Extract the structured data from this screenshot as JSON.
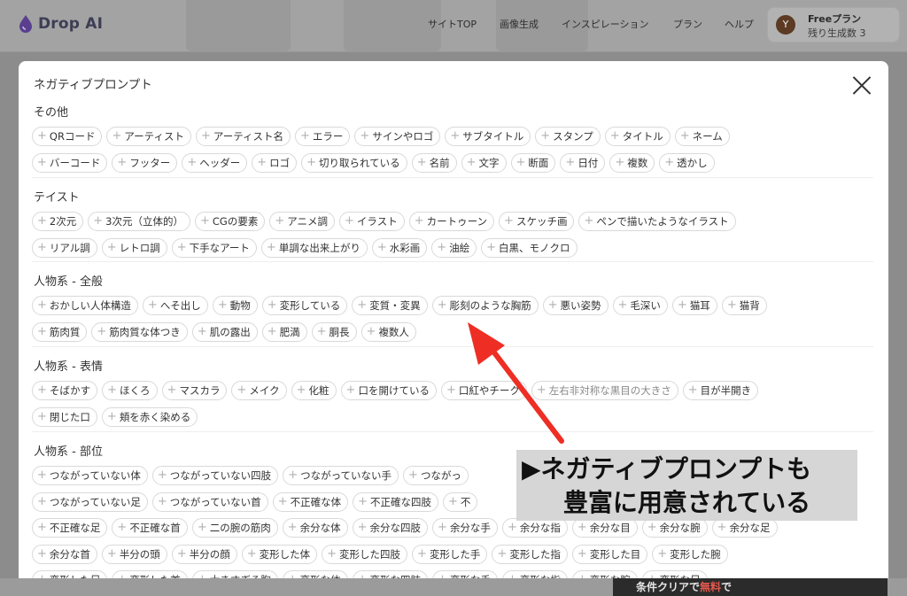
{
  "header": {
    "logo_text": "Drop AI",
    "nav": [
      "サイトTOP",
      "画像生成",
      "インスピレーション",
      "プラン",
      "ヘルプ"
    ],
    "plan": {
      "avatar": "Y",
      "name": "Freeプラン",
      "remaining": "残り生成数 3"
    }
  },
  "modal": {
    "title": "ネガティブプロンプト",
    "sections": [
      {
        "title": "その他",
        "rows": [
          [
            "QRコード",
            "アーティスト",
            "アーティスト名",
            "エラー",
            "サインやロゴ",
            "サブタイトル",
            "スタンプ",
            "タイトル",
            "ネーム"
          ],
          [
            "バーコード",
            "フッター",
            "ヘッダー",
            "ロゴ",
            "切り取られている",
            "名前",
            "文字",
            "断面",
            "日付",
            "複数",
            "透かし"
          ]
        ]
      },
      {
        "title": "テイスト",
        "rows": [
          [
            "2次元",
            "3次元（立体的）",
            "CGの要素",
            "アニメ調",
            "イラスト",
            "カートゥーン",
            "スケッチ画",
            "ペンで描いたようなイラスト"
          ],
          [
            "リアル調",
            "レトロ調",
            "下手なアート",
            "単調な出来上がり",
            "水彩画",
            "油絵",
            "白黒、モノクロ"
          ]
        ]
      },
      {
        "title": "人物系 - 全般",
        "rows": [
          [
            "おかしい人体構造",
            "へそ出し",
            "動物",
            "変形している",
            "変質・変異",
            "彫刻のような胸筋",
            "悪い姿勢",
            "毛深い",
            "猫耳",
            "猫背"
          ],
          [
            "筋肉質",
            "筋肉質な体つき",
            "肌の露出",
            "肥満",
            "胴長",
            "複数人"
          ]
        ]
      },
      {
        "title": "人物系 - 表情",
        "rows": [
          [
            "そばかす",
            "ほくろ",
            "マスカラ",
            "メイク",
            "化粧",
            "口を開けている",
            "口紅やチーク",
            "左右非対称な黒目の大きさ",
            "目が半開き"
          ],
          [
            "閉じた口",
            "頬を赤く染める"
          ]
        ]
      },
      {
        "title": "人物系 - 部位",
        "rows": [
          [
            "つながっていない体",
            "つながっていない四肢",
            "つながっていない手",
            "つながっ"
          ],
          [
            "つながっていない足",
            "つながっていない首",
            "不正確な体",
            "不正確な四肢",
            "不"
          ],
          [
            "不正確な足",
            "不正確な首",
            "二の腕の筋肉",
            "余分な体",
            "余分な四肢",
            "余分な手",
            "余分な指",
            "余分な目",
            "余分な腕",
            "余分な足"
          ],
          [
            "余分な首",
            "半分の頭",
            "半分の顔",
            "変形した体",
            "変形した四肢",
            "変形した手",
            "変形した指",
            "変形した目",
            "変形した腕"
          ],
          [
            "変形した足",
            "変形した首",
            "大きすぎる胸",
            "変形な体",
            "変形な四肢",
            "変形な手",
            "変形な指",
            "変形な腕",
            "変形な足"
          ]
        ]
      }
    ],
    "dim_chip": "左右非対称な黒目の大きさ"
  },
  "annotation": {
    "line1": "▶ネガティブプロンプトも",
    "line2": "豊富に用意されている",
    "color": "#ee2e24"
  },
  "promo": {
    "text_before": "条件クリアで",
    "highlight": "無料",
    "text_after": "で"
  }
}
